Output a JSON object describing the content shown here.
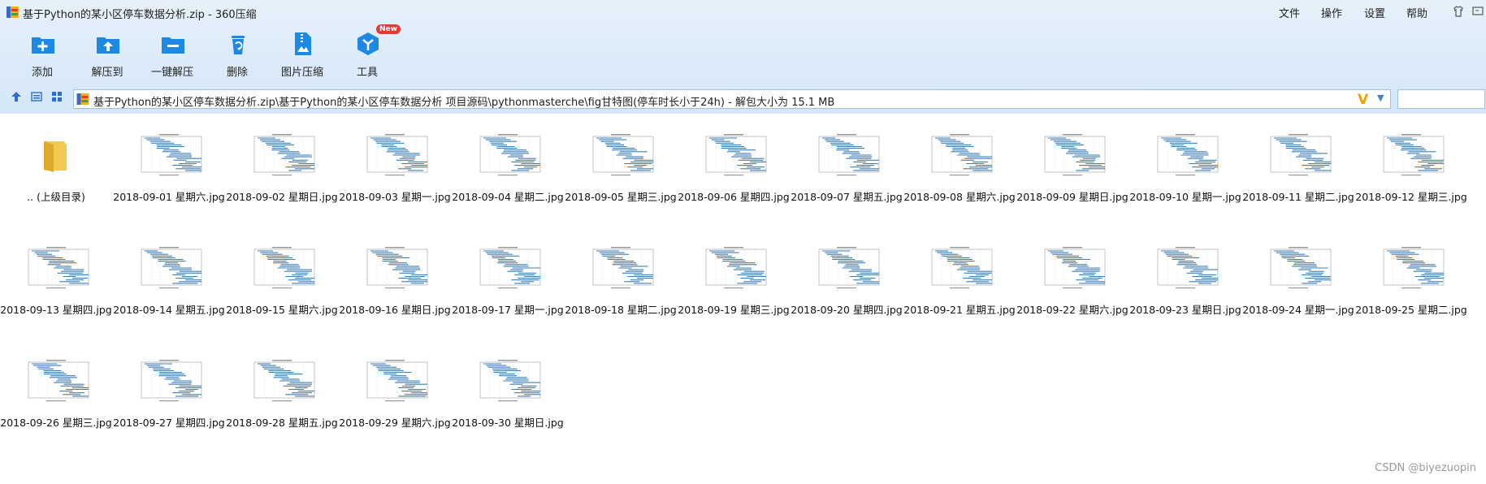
{
  "window": {
    "title": "基于Python的某小区停车数据分析.zip - 360压缩",
    "menus": [
      "文件",
      "操作",
      "设置",
      "帮助"
    ]
  },
  "toolbar": {
    "items": [
      {
        "label": "添加",
        "icon": "add-icon"
      },
      {
        "label": "解压到",
        "icon": "extract-to-icon"
      },
      {
        "label": "一键解压",
        "icon": "one-click-extract-icon"
      },
      {
        "label": "删除",
        "icon": "delete-icon"
      },
      {
        "label": "图片压缩",
        "icon": "image-compress-icon"
      },
      {
        "label": "工具",
        "icon": "tools-icon",
        "badge": "New"
      }
    ]
  },
  "address": {
    "path": "基于Python的某小区停车数据分析.zip\\基于Python的某小区停车数据分析 项目源码\\pythonmasterche\\fig甘特图(停车时长小于24h) - 解包大小为 15.1 MB"
  },
  "files": [
    ".. (上级目录)",
    "2018-09-01 星期六.jpg",
    "2018-09-02 星期日.jpg",
    "2018-09-03 星期一.jpg",
    "2018-09-04 星期二.jpg",
    "2018-09-05 星期三.jpg",
    "2018-09-06 星期四.jpg",
    "2018-09-07 星期五.jpg",
    "2018-09-08 星期六.jpg",
    "2018-09-09 星期日.jpg",
    "2018-09-10 星期一.jpg",
    "2018-09-11 星期二.jpg",
    "2018-09-12 星期三.jpg",
    "2018-09-13 星期四.jpg",
    "2018-09-14 星期五.jpg",
    "2018-09-15 星期六.jpg",
    "2018-09-16 星期日.jpg",
    "2018-09-17 星期一.jpg",
    "2018-09-18 星期二.jpg",
    "2018-09-19 星期三.jpg",
    "2018-09-20 星期四.jpg",
    "2018-09-21 星期五.jpg",
    "2018-09-22 星期六.jpg",
    "2018-09-23 星期日.jpg",
    "2018-09-24 星期一.jpg",
    "2018-09-25 星期二.jpg",
    "2018-09-26 星期三.jpg",
    "2018-09-27 星期四.jpg",
    "2018-09-28 星期五.jpg",
    "2018-09-29 星期六.jpg",
    "2018-09-30 星期日.jpg"
  ],
  "watermark": "CSDN @biyezuopin",
  "colors": {
    "accent": "#1e88e5",
    "chrome": "#dcebf9",
    "thumb_bar": "#3b7fb6"
  }
}
